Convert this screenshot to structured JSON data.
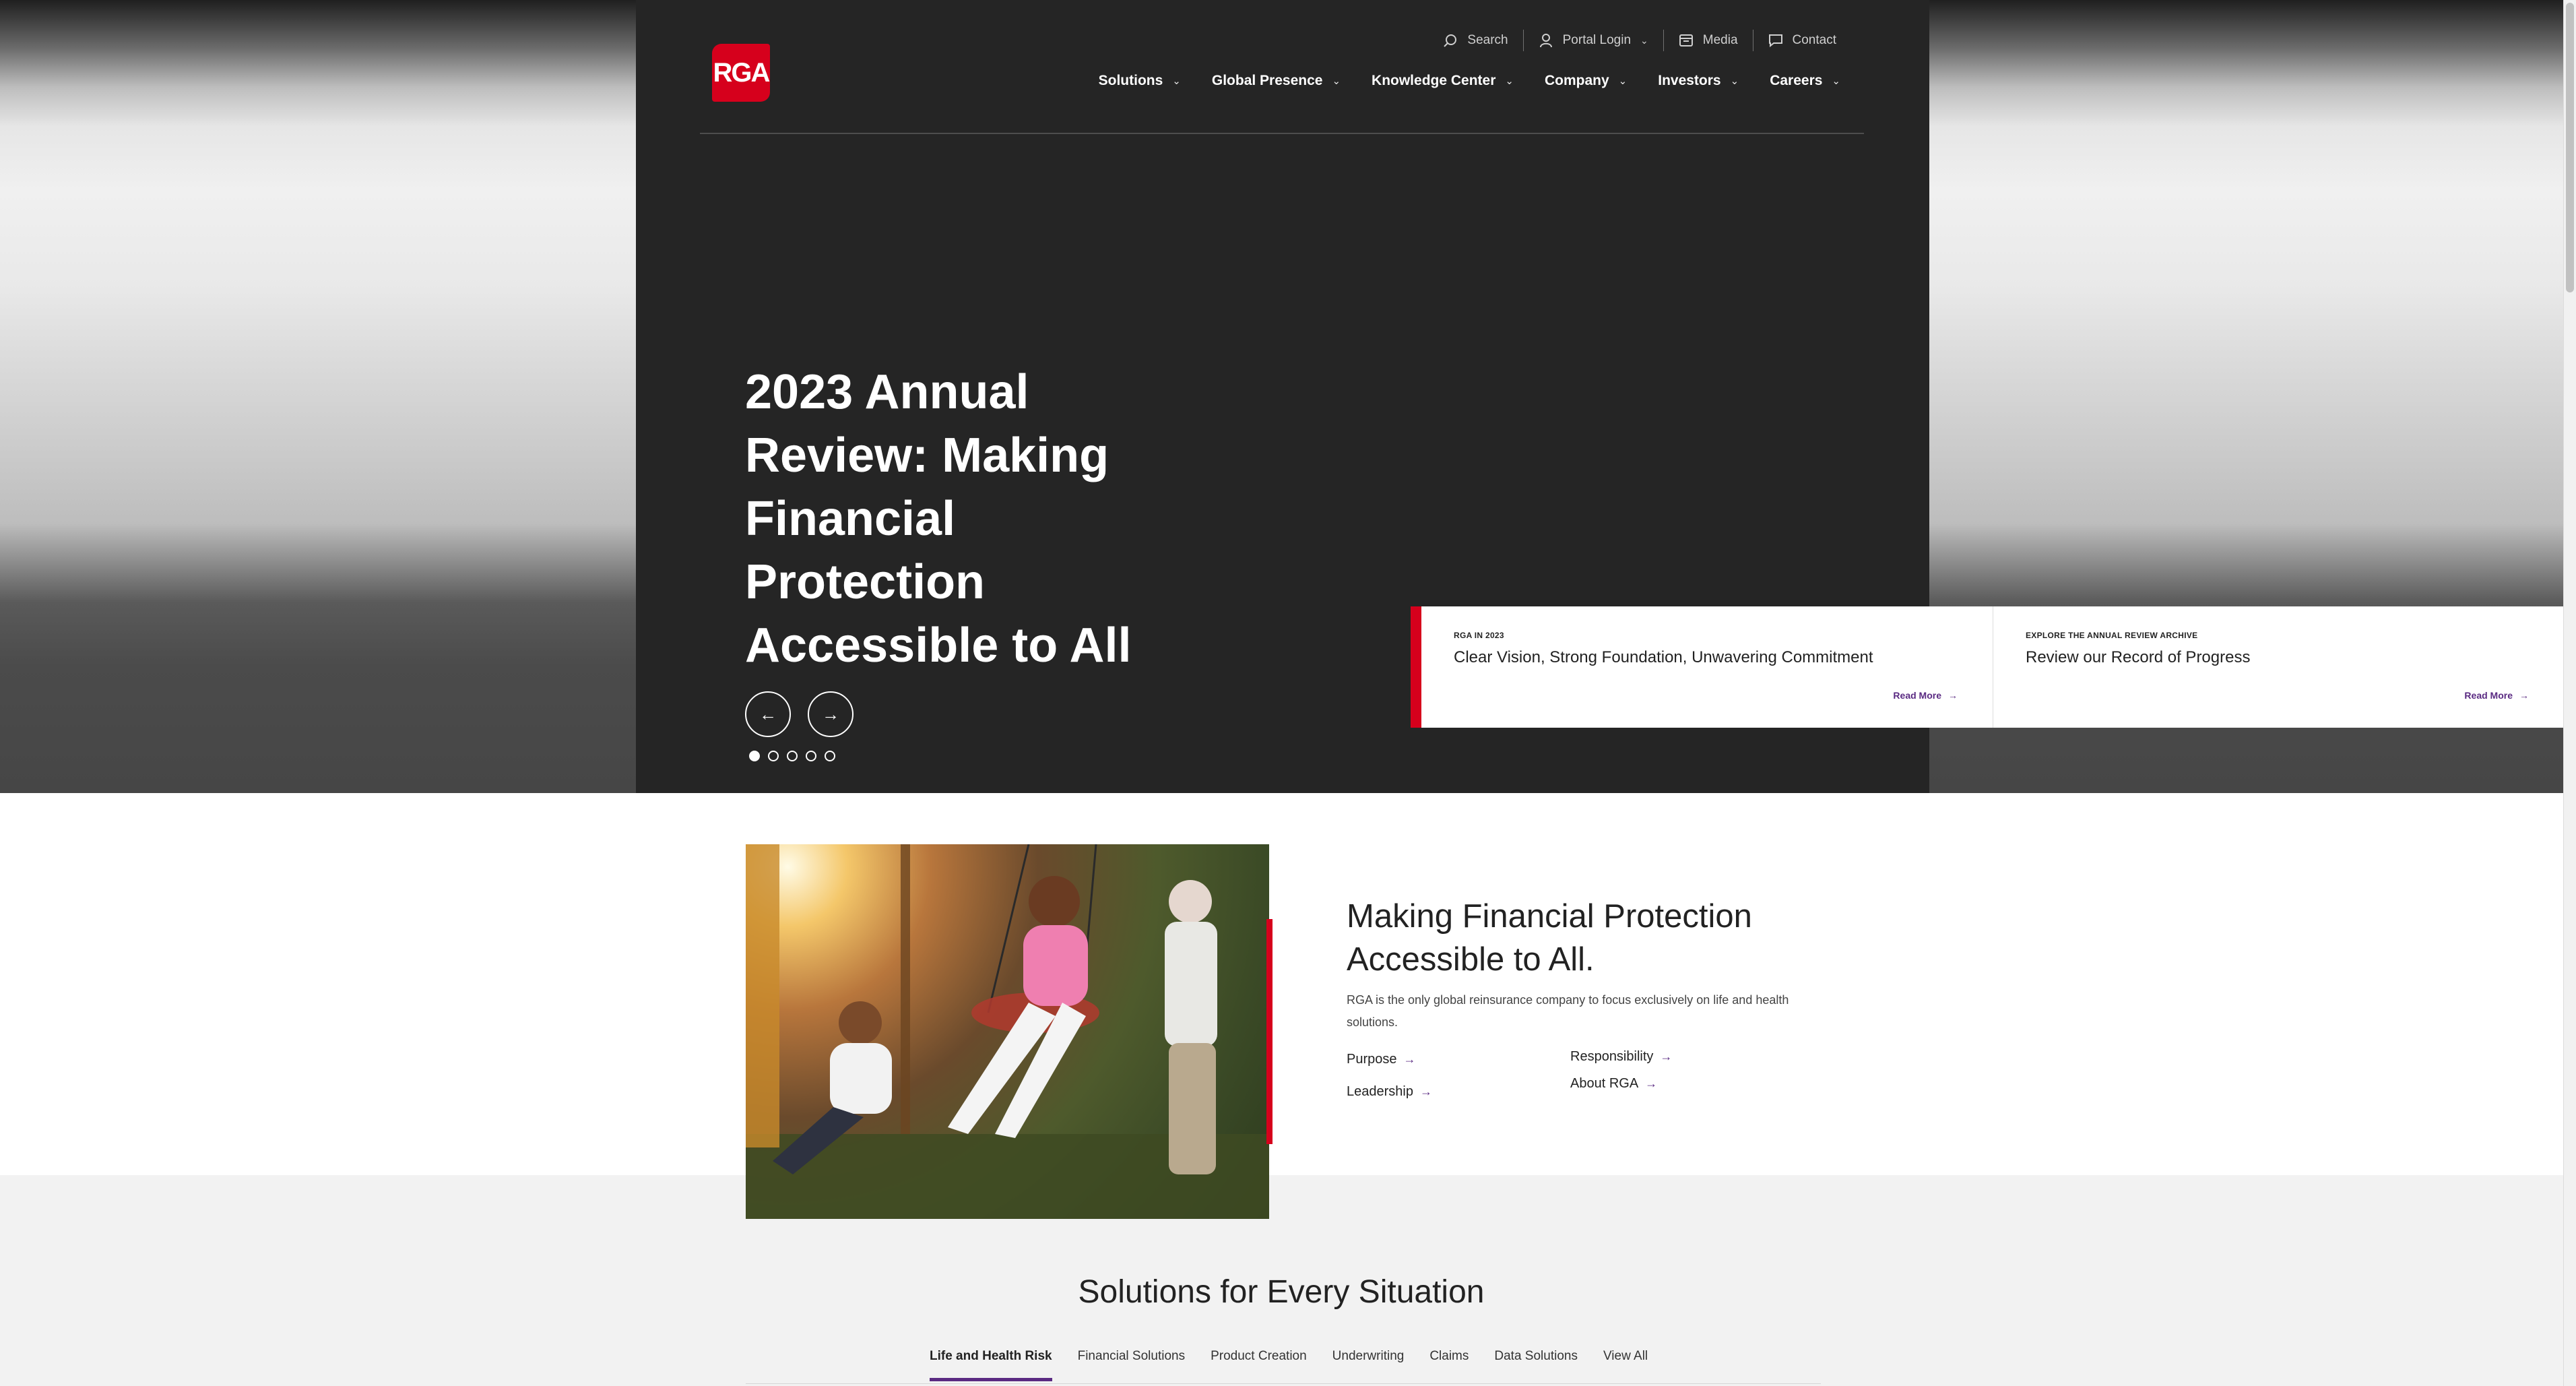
{
  "brand": {
    "logo_text": "RGA",
    "accent_color": "#d6001c",
    "link_color": "#5a2a82"
  },
  "utility_nav": [
    {
      "label": "Search",
      "icon": "search-icon"
    },
    {
      "label": "Portal Login",
      "icon": "user-icon"
    },
    {
      "label": "Media",
      "icon": "media-icon"
    },
    {
      "label": "Contact",
      "icon": "chat-icon"
    }
  ],
  "main_nav": [
    {
      "label": "Solutions"
    },
    {
      "label": "Global Presence"
    },
    {
      "label": "Knowledge Center"
    },
    {
      "label": "Company"
    },
    {
      "label": "Investors"
    },
    {
      "label": "Careers"
    }
  ],
  "hero": {
    "title": "2023 Annual Review: Making Financial Protection Accessible to All",
    "prev_icon": "arrow-left-icon",
    "next_icon": "arrow-right-icon",
    "slide_count": 5,
    "active_slide": 1
  },
  "cards": [
    {
      "eyebrow": "RGA IN 2023",
      "title": "Clear Vision, Strong Foundation, Unwavering Commitment",
      "link": "Read More"
    },
    {
      "eyebrow": "EXPLORE THE ANNUAL REVIEW ARCHIVE",
      "title": "Review our Record of Progress",
      "link": "Read More"
    }
  ],
  "about": {
    "title": "Making Financial Protection Accessible to All.",
    "text": "RGA is the only global reinsurance company to focus exclusively on life and health solutions.",
    "links": [
      "Purpose",
      "Leadership",
      "Responsibility",
      "About RGA"
    ]
  },
  "solutions": {
    "title": "Solutions for Every Situation",
    "tabs": [
      "Life and Health Risk",
      "Financial Solutions",
      "Product Creation",
      "Underwriting",
      "Claims",
      "Data Solutions",
      "View All"
    ],
    "active_tab": 0
  }
}
